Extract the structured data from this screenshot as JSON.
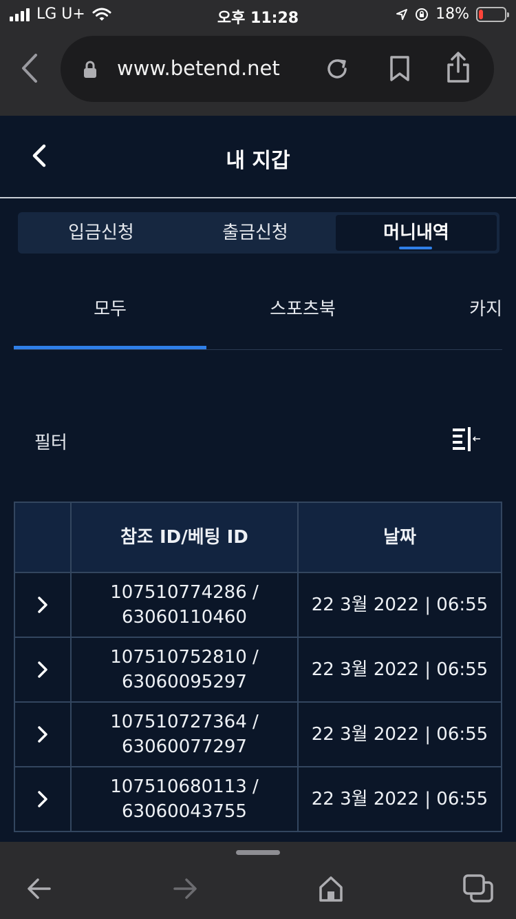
{
  "status_bar": {
    "carrier": "LG U+",
    "time": "오후 11:28",
    "battery": "18%",
    "battery_level": 0.18,
    "battery_color": "#ff453a"
  },
  "browser": {
    "url": "www.betend.net",
    "icons": [
      "back-icon",
      "lock-icon",
      "reload-icon",
      "bookmark-icon",
      "share-icon"
    ]
  },
  "header": {
    "title": "내 지갑"
  },
  "segments": {
    "items": [
      "입금신청",
      "출금신청",
      "머니내역"
    ],
    "active": "머니내역"
  },
  "subtabs": {
    "items": [
      "모두",
      "스포츠북",
      "카지"
    ],
    "active": "모두"
  },
  "filter": {
    "label": "필터",
    "icon": "filter-collapse-icon"
  },
  "table": {
    "headers": [
      "",
      "참조 ID/베팅 ID",
      "날짜"
    ],
    "rows": [
      {
        "ref_id": "107510774286 /",
        "bet_id": "63060110460",
        "date": "22 3월 2022 | 06:55"
      },
      {
        "ref_id": "107510752810 /",
        "bet_id": "63060095297",
        "date": "22 3월 2022 | 06:55"
      },
      {
        "ref_id": "107510727364 /",
        "bet_id": "63060077297",
        "date": "22 3월 2022 | 06:55"
      },
      {
        "ref_id": "107510680113 /",
        "bet_id": "63060043755",
        "date": "22 3월 2022 | 06:55"
      }
    ]
  },
  "toolbar": {
    "icons": [
      "back-arrow-icon",
      "forward-arrow-icon",
      "home-icon",
      "tabs-icon"
    ]
  },
  "colors": {
    "background": "#0b1628",
    "accent": "#2f7fe8",
    "browser_chrome": "#2c2c2e"
  }
}
